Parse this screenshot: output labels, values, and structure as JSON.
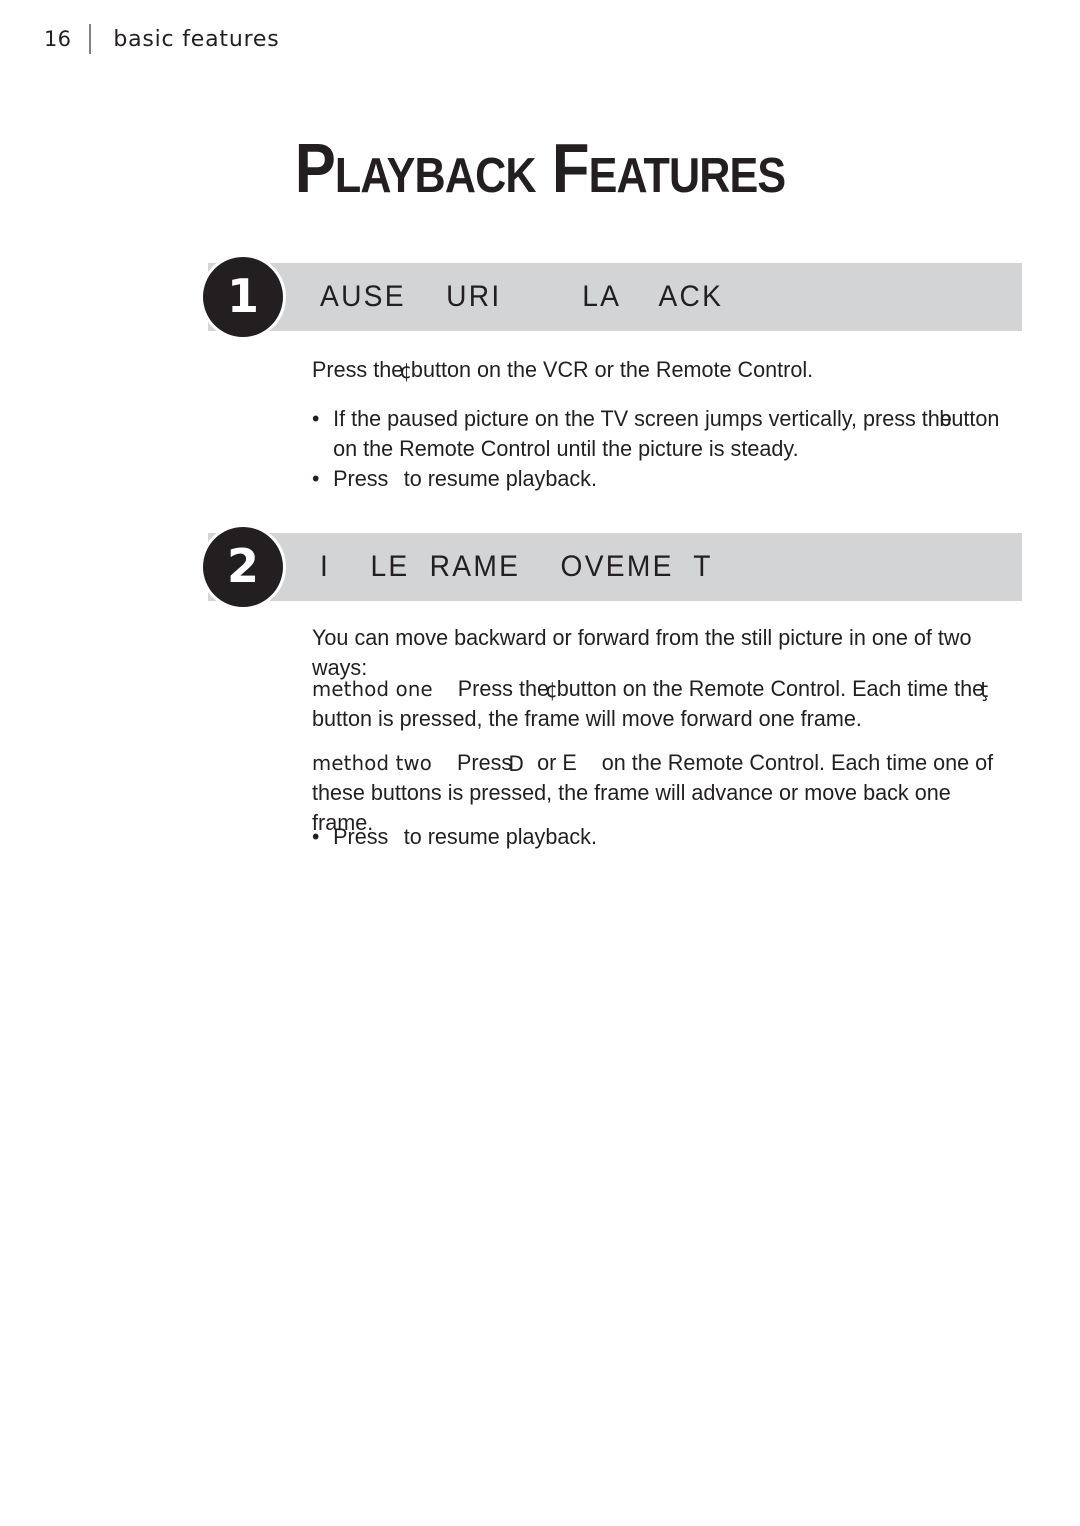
{
  "header": {
    "page_number": "16",
    "label": "basic features"
  },
  "title": "Playback Features",
  "sections": [
    {
      "badge": "1",
      "heading": "AUSE    URI        LA    ACK",
      "intro": {
        "before": "Press the",
        "glyph": "¢",
        "after": "button on the VCR or the Remote Control."
      },
      "bullets": [
        {
          "dot": "•",
          "before": "If the paused picture on the TV screen jumps vertically, press the",
          "after": "button on the Remote Control until the picture is steady."
        },
        {
          "dot": "•",
          "before": "Press",
          "after": "to resume playback."
        }
      ]
    },
    {
      "badge": "2",
      "heading": "I    LE  RAME    OVEME  T",
      "intro": "You can move backward or forward from the still picture in one of two ways:",
      "methods": [
        {
          "label": "method one",
          "before": "Press the",
          "glyph": "¢",
          "middle": "button on the Remote Control. Each time the",
          "glyph2": "ţ",
          "after": "button is pressed, the frame will move forward one frame."
        },
        {
          "label": "method two",
          "before": "Press",
          "glyph": "D",
          "middle": "or E",
          "after": "on the Remote Control. Each time one of these buttons is pressed, the frame will advance or move back one frame."
        }
      ],
      "bullets": [
        {
          "dot": "•",
          "before": "Press",
          "after": "to resume playback."
        }
      ]
    }
  ],
  "colors": {
    "ink": "#231f20",
    "bar": "#d3d4d6",
    "rule": "#8a7f80"
  }
}
